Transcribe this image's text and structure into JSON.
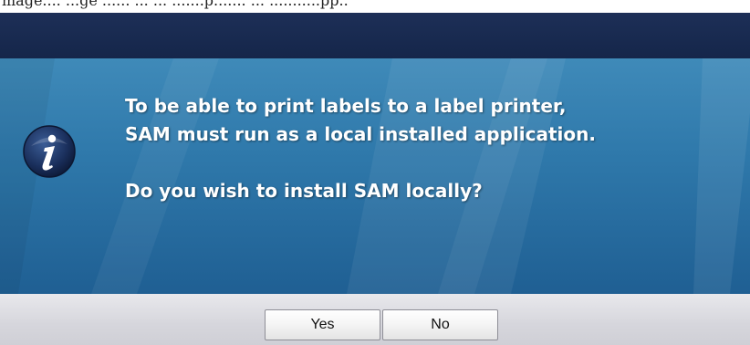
{
  "dialog": {
    "top_strip_text": "mage.... ...ge ...... ... ... .......p....... ... ...........pp..",
    "icon": "info-icon",
    "message_lines": [
      "To be able to print labels to a label printer,",
      "SAM must run as a local installed application."
    ],
    "question": "Do you wish to install SAM locally?",
    "buttons": {
      "yes_label": "Yes",
      "no_label": "No"
    }
  },
  "colors": {
    "titlebar": "#15264a",
    "content_top": "#3f8ab9",
    "content_bottom": "#1f5f93",
    "footer": "#d6d6dc",
    "text": "#ffffff"
  }
}
